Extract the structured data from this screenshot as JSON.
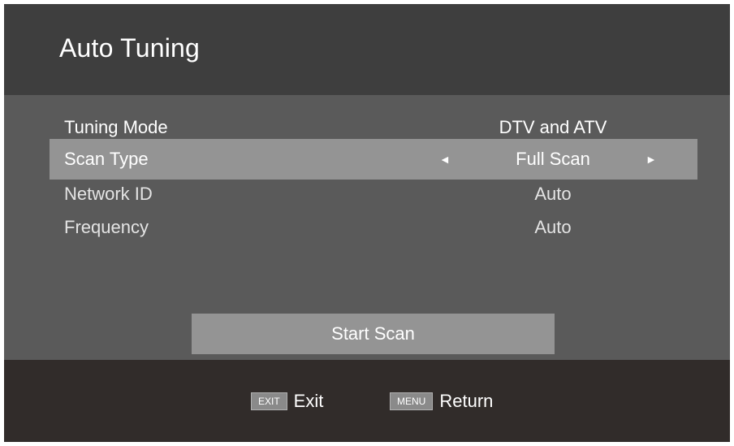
{
  "header": {
    "title": "Auto Tuning"
  },
  "rows": [
    {
      "label": "Tuning Mode",
      "value": "DTV and ATV"
    },
    {
      "label": "Scan Type",
      "value": "Full Scan",
      "left_arrow": "◄",
      "right_arrow": "►"
    },
    {
      "label": "Network ID",
      "value": "Auto"
    },
    {
      "label": "Frequency",
      "value": "Auto"
    }
  ],
  "start_button": {
    "label": "Start Scan"
  },
  "footer": {
    "exit_key": "EXIT",
    "exit_label": "Exit",
    "menu_key": "MENU",
    "menu_label": "Return"
  },
  "colors": {
    "header_bg": "#3e3e3e",
    "panel_bg": "#5a5a5a",
    "highlight_bg": "#949494",
    "footer_bg": "#312c2a"
  }
}
